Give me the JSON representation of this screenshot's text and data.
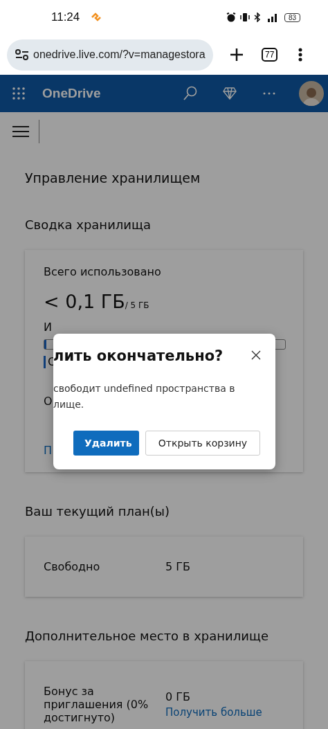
{
  "status_bar": {
    "time": "11:24",
    "battery": "83"
  },
  "browser": {
    "url": "onedrive.live.com/?v=managestora",
    "tab_count": "77"
  },
  "app_header": {
    "title": "OneDrive"
  },
  "page": {
    "title": "Управление хранилищем",
    "summary": {
      "heading": "Сводка хранилища",
      "label": "Всего использовано",
      "used": "< 0,1 ГБ",
      "total": "/ 5 ГБ",
      "usage_label": "И",
      "usage_bar": {
        "level": 0.01
      },
      "legend_label": "С",
      "note_fragment": "О",
      "link_fragment": "П"
    },
    "plans": {
      "heading": "Ваш текущий план(ы)",
      "rows": [
        {
          "label": "Свободно",
          "value": "5 ГБ"
        }
      ]
    },
    "extra": {
      "heading": "Дополнительное место в хранилище",
      "rows": [
        {
          "label": "Бонус за приглашения (0% достигнуто)",
          "value": "0 ГБ",
          "link": "Получить больше"
        }
      ]
    }
  },
  "dialog": {
    "title": "лить окончательно?",
    "message_lines": [
      "свободит undefined пространства в",
      "лище."
    ],
    "buttons": [
      {
        "label": "Удалить",
        "kind": "primary"
      },
      {
        "label": "Открыть корзину",
        "kind": "secondary"
      }
    ]
  }
}
